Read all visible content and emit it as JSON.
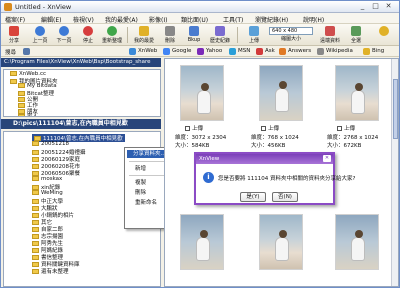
{
  "window": {
    "title": "Untitled - XnView"
  },
  "menubar": [
    "檔案(F)",
    "編輯(E)",
    "檢視(V)",
    "我的最愛(A)",
    "影像(I)",
    "類比面(U)",
    "工具(T)",
    "瀏覽紀錄(H)",
    "說明(H)"
  ],
  "toolbar": {
    "buttons": [
      {
        "label": "分享",
        "icon": "share-icon",
        "color": "#d9443a"
      },
      {
        "label": "上一頁",
        "icon": "back-icon",
        "color": "#3d7ad6"
      },
      {
        "label": "下一頁",
        "icon": "forward-icon",
        "color": "#3d7ad6"
      },
      {
        "label": "停止",
        "icon": "stop-icon",
        "color": "#d63d3d"
      },
      {
        "label": "重新整理",
        "icon": "refresh-icon",
        "color": "#3fa64a"
      },
      {
        "label": "我的最愛",
        "icon": "star-icon",
        "color": "#e0b128"
      },
      {
        "label": "刪除",
        "icon": "delete-icon",
        "color": "#888888"
      },
      {
        "label": "Bkup",
        "icon": "backup-icon",
        "color": "#4a7ccf"
      },
      {
        "label": "歷史紀錄",
        "icon": "history-icon",
        "color": "#7a6bd0"
      },
      {
        "label": "上傳",
        "icon": "upload-icon",
        "color": "#5aa0d8"
      },
      {
        "label": "縮圖大小",
        "icon": "thumbnail-size-icon",
        "color": "#6f8fc9"
      },
      {
        "label": "遠端資料",
        "icon": "remote-icon",
        "color": "#cf4d4d"
      },
      {
        "label": "全選",
        "icon": "select-all-icon",
        "color": "#5a9a5a"
      }
    ],
    "size_value": "640 x 480"
  },
  "links_bar": {
    "search_label": "搜尋",
    "links": [
      "XnWeb",
      "Google",
      "Yahoo",
      "MSN",
      "Ask",
      "Answers",
      "Wikipedia",
      "Bing"
    ]
  },
  "path_top": "C:\\Program Files\\XnView\\XnWeb\\Bsp\\Bootstrap_share",
  "tree_top": [
    "XnWeb.cc",
    "我的圖片資料夾",
    "My Bitdata",
    "Bitcat整理",
    "公開",
    "工作",
    "朋友",
    "家人"
  ],
  "path_current": "D:\\pics\\111104\\曾志,在內職員中相見歡",
  "tree_bottom": [
    "111104\\曾志,在內職員中相見歡",
    "20051218",
    "20051224婚禮攝",
    "20060129家庭",
    "20060208花市",
    "20060506聚餐",
    "moskax",
    "xin紀錄",
    "WeMing",
    "中正大學",
    "大鵬狀",
    "小鍋鍋的相片",
    "其它",
    "自家二郎",
    "志宗揚園",
    "阿秀先生",
    "阿媽紀錄",
    "書信整理",
    "資料關鍵資料庫",
    "還有未整理"
  ],
  "context_menu": [
    "分享資料夾...",
    "新增",
    "複製",
    "刪除",
    "重新命名"
  ],
  "thumbnails": [
    {
      "check": "上傳",
      "dims": "維度：3072 x 2304",
      "size": "大小：584KB"
    },
    {
      "check": "上傳",
      "dims": "維度：768 x 1024",
      "size": "大小：456KB"
    },
    {
      "check": "上傳",
      "dims": "維度：2768 x 1024",
      "size": "大小：672KB"
    }
  ],
  "dialog": {
    "title": "XnView",
    "message": "您是否要將 111104 資料夾中相關的資料夾分享給大家?",
    "yes_label": "是(Y)",
    "no_label": "否(N)"
  }
}
